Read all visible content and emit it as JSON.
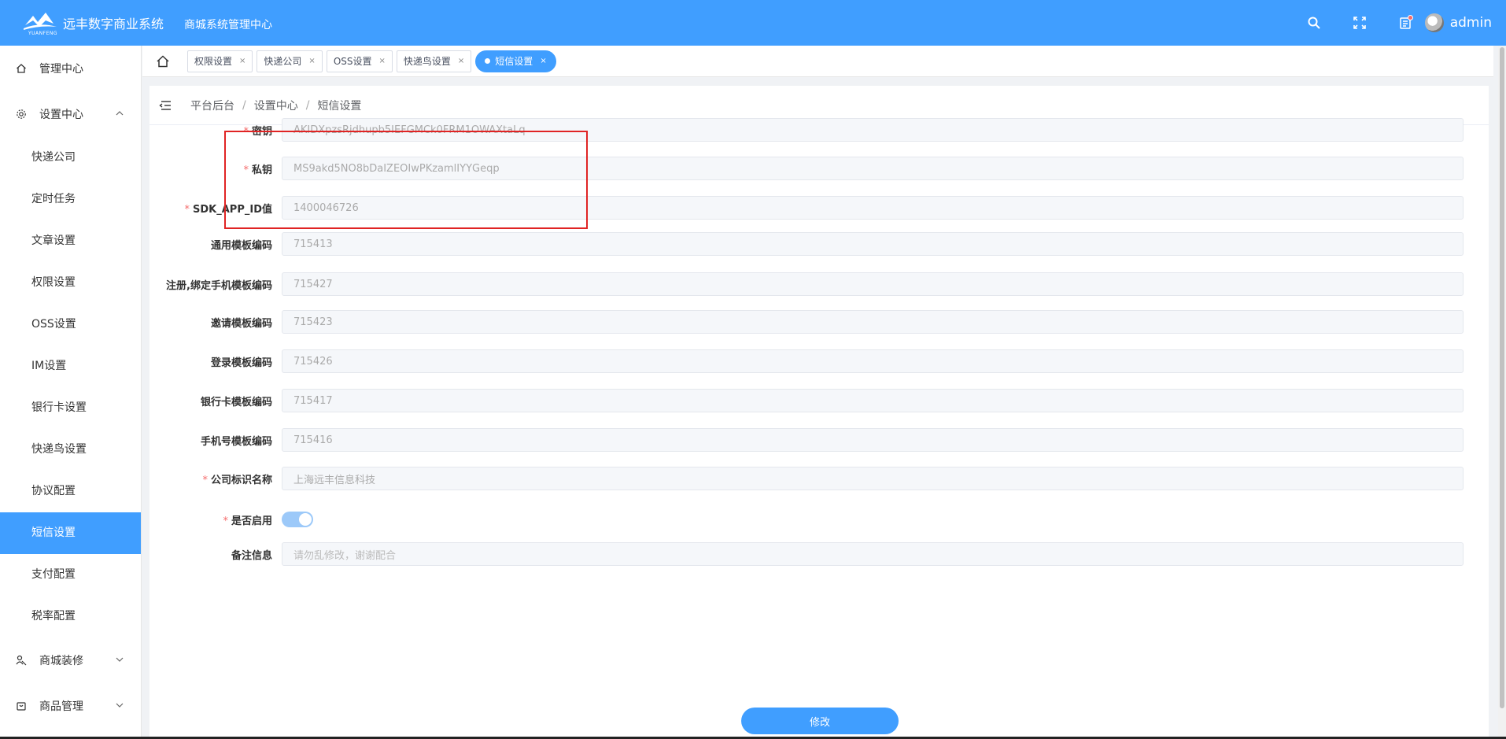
{
  "header": {
    "logo_text": "YUANFENG",
    "app_title": "远丰数字商业系统",
    "subtitle": "商城系统管理中心",
    "username": "admin",
    "colors": {
      "primary": "#409eff",
      "danger": "#f56c6c"
    }
  },
  "sidebar": {
    "groups": [
      {
        "label": "管理中心",
        "icon": "home-icon"
      },
      {
        "label": "设置中心",
        "icon": "gear-icon",
        "expanded": true
      }
    ],
    "items": [
      {
        "label": "快递公司"
      },
      {
        "label": "定时任务"
      },
      {
        "label": "文章设置"
      },
      {
        "label": "权限设置"
      },
      {
        "label": "OSS设置"
      },
      {
        "label": "IM设置"
      },
      {
        "label": "银行卡设置"
      },
      {
        "label": "快递鸟设置"
      },
      {
        "label": "协议配置"
      },
      {
        "label": "短信设置",
        "active": true
      },
      {
        "label": "支付配置"
      },
      {
        "label": "税率配置"
      }
    ],
    "groups_bottom": [
      {
        "label": "商城装修",
        "icon": "decor-icon"
      },
      {
        "label": "商品管理",
        "icon": "goods-icon"
      }
    ]
  },
  "tags": [
    {
      "label": "权限设置",
      "close": "×"
    },
    {
      "label": "快递公司",
      "close": "×"
    },
    {
      "label": "OSS设置",
      "close": "×"
    },
    {
      "label": "快递鸟设置",
      "close": "×"
    },
    {
      "label": "短信设置",
      "close": "×",
      "active": true
    }
  ],
  "breadcrumb": {
    "items": [
      "平台后台",
      "设置中心",
      "短信设置"
    ],
    "separator": "/"
  },
  "form": {
    "fields": [
      {
        "label": "密钥",
        "required": true,
        "value": "AKIDXpzsRjdhupb5IEFGMCk0FRM1OWAXtaLq"
      },
      {
        "label": "私钥",
        "required": true,
        "value": "MS9akd5NO8bDaIZEOIwPKzamlIYYGeqp"
      },
      {
        "label": "SDK_APP_ID值",
        "required": true,
        "value": "1400046726"
      },
      {
        "label": "通用模板编码",
        "required": false,
        "value": "715413"
      },
      {
        "label": "注册,绑定手机模板编码",
        "required": false,
        "value": "715427"
      },
      {
        "label": "邀请模板编码",
        "required": false,
        "value": "715423"
      },
      {
        "label": "登录模板编码",
        "required": false,
        "value": "715426"
      },
      {
        "label": "银行卡模板编码",
        "required": false,
        "value": "715417"
      },
      {
        "label": "手机号模板编码",
        "required": false,
        "value": "715416"
      },
      {
        "label": "公司标识名称",
        "required": true,
        "value": "上海远丰信息科技"
      }
    ],
    "enable": {
      "label": "是否启用",
      "required": true,
      "on": true
    },
    "remark": {
      "label": "备注信息",
      "placeholder": "请勿乱修改，谢谢配合"
    },
    "required_mark": "*",
    "submit_label": "修改"
  }
}
